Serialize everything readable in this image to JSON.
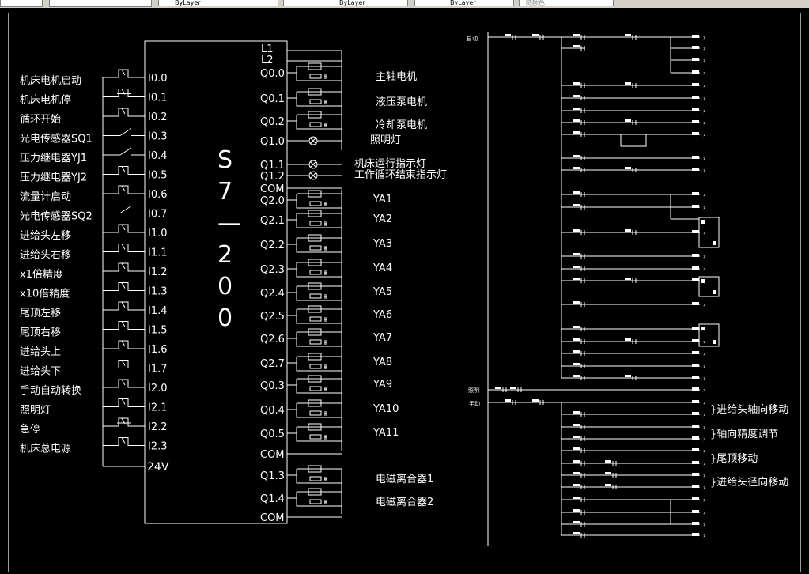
{
  "toolbar": {
    "layer_name": "",
    "color": "ByLayer",
    "linetype": "ByLayer",
    "lineweight": "ByLayer",
    "plot_style": "随颜色"
  },
  "plc": {
    "model_label": "S7—200",
    "inputs": [
      {
        "label": "机床电机启动",
        "addr": "I0.0",
        "contact": "NO"
      },
      {
        "label": "机床电机停",
        "addr": "I0.1",
        "contact": "NC"
      },
      {
        "label": "循环开始",
        "addr": "I0.2",
        "contact": "NO"
      },
      {
        "label": "光电传感器SQ1",
        "addr": "I0.3",
        "contact": "SW"
      },
      {
        "label": "压力继电器YJ1",
        "addr": "I0.4",
        "contact": "SW"
      },
      {
        "label": "压力继电器YJ2",
        "addr": "I0.5",
        "contact": "NO"
      },
      {
        "label": "流量计启动",
        "addr": "I0.6",
        "contact": "NO"
      },
      {
        "label": "光电传感器SQ2",
        "addr": "I0.7",
        "contact": "SW"
      },
      {
        "label": "进给头左移",
        "addr": "I1.0",
        "contact": "NO"
      },
      {
        "label": "进给头右移",
        "addr": "I1.1",
        "contact": "NO"
      },
      {
        "label": "x1倍精度",
        "addr": "I1.2",
        "contact": "NO"
      },
      {
        "label": "x10倍精度",
        "addr": "I1.3",
        "contact": "NO"
      },
      {
        "label": "尾顶左移",
        "addr": "I1.4",
        "contact": "NO"
      },
      {
        "label": "尾顶右移",
        "addr": "I1.5",
        "contact": "NO"
      },
      {
        "label": "进给头上",
        "addr": "I1.6",
        "contact": "NO"
      },
      {
        "label": "进给头下",
        "addr": "I1.7",
        "contact": "NO"
      },
      {
        "label": "手动自动转换",
        "addr": "I2.0",
        "contact": "NO"
      },
      {
        "label": "照明灯",
        "addr": "I2.1",
        "contact": "NO"
      },
      {
        "label": "急停",
        "addr": "I2.2",
        "contact": "NC"
      },
      {
        "label": "机床总电源",
        "addr": "I2.3",
        "contact": "NO"
      }
    ],
    "supply_label": "24V",
    "power_labels": [
      "L1",
      "L2"
    ],
    "outputs": [
      {
        "addr": "Q0.0",
        "label": "主轴电机",
        "kind": "relay"
      },
      {
        "addr": "Q0.1",
        "label": "液压泵电机",
        "kind": "relay"
      },
      {
        "addr": "Q0.2",
        "label": "冷却泵电机",
        "kind": "relay"
      },
      {
        "addr": "Q1.0",
        "label": "照明灯",
        "kind": "lamp"
      },
      {
        "addr": "Q1.1",
        "label": "机床运行指示灯",
        "kind": "lamp"
      },
      {
        "addr": "Q1.2",
        "label": "工作循环结束指示灯",
        "kind": "lamp"
      },
      {
        "addr": "COM",
        "label": "",
        "kind": "com"
      },
      {
        "addr": "Q2.0",
        "label": "YA1",
        "kind": "relay"
      },
      {
        "addr": "Q2.1",
        "label": "YA2",
        "kind": "relay"
      },
      {
        "addr": "Q2.2",
        "label": "YA3",
        "kind": "relay"
      },
      {
        "addr": "Q2.3",
        "label": "YA4",
        "kind": "relay"
      },
      {
        "addr": "Q2.4",
        "label": "YA5",
        "kind": "relay"
      },
      {
        "addr": "Q2.5",
        "label": "YA6",
        "kind": "relay"
      },
      {
        "addr": "Q2.6",
        "label": "YA7",
        "kind": "relay"
      },
      {
        "addr": "Q2.7",
        "label": "YA8",
        "kind": "relay"
      },
      {
        "addr": "Q0.3",
        "label": "YA9",
        "kind": "relay"
      },
      {
        "addr": "Q0.4",
        "label": "YA10",
        "kind": "relay"
      },
      {
        "addr": "Q0.5",
        "label": "YA11",
        "kind": "relay"
      },
      {
        "addr": "COM",
        "label": "",
        "kind": "com"
      },
      {
        "addr": "Q1.3",
        "label": "电磁离合器1",
        "kind": "relay"
      },
      {
        "addr": "Q1.4",
        "label": "电磁离合器2",
        "kind": "relay"
      },
      {
        "addr": "COM",
        "label": "",
        "kind": "com"
      }
    ]
  },
  "ladder": {
    "auto_label": "自动",
    "light_label": "照明",
    "manual_label": "手动",
    "group_labels": [
      "}进给头轴向移动",
      "}轴向精度调节",
      "}尾顶移动",
      "}进给头径向移动"
    ]
  }
}
